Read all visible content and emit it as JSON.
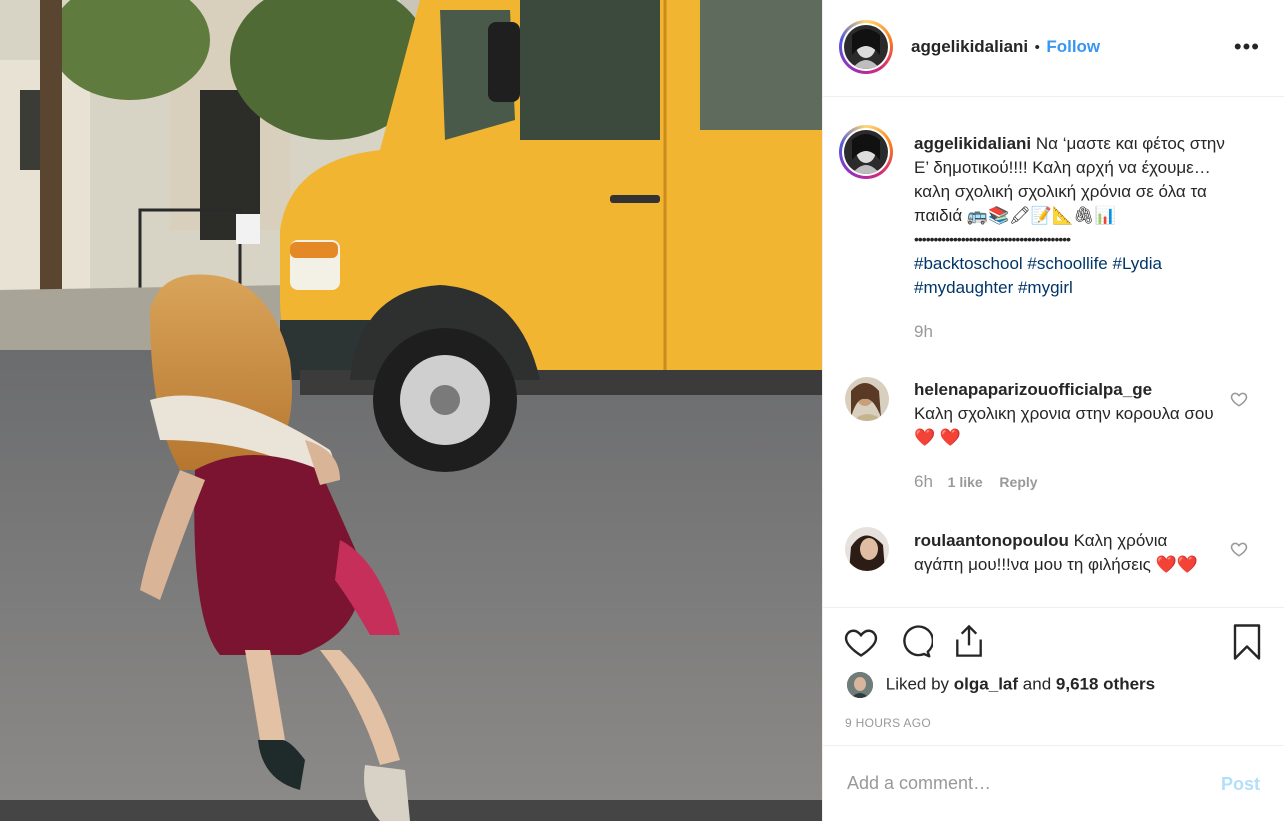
{
  "post": {
    "username": "aggelikidaliani",
    "separator": "•",
    "follow_label": "Follow",
    "more_icon": "ellipsis-icon",
    "caption_text": "Να ‘μαστε και φέτος στην Ε’ δημοτικού!!!! Καλη αρχή να έχουμε… καλη σχολική σχολική χρόνια σε όλα τα παιδιά 🚌📚🖍📝📐🖇📊",
    "divider": "••••••••••••••••••••••••••••••••••••••••",
    "hashtags": [
      "#backtoschool",
      "#schoollife",
      "#Lydia",
      "#mydaughter",
      "#mygirl"
    ],
    "caption_age": "9h"
  },
  "comments": [
    {
      "username": "helenapaparizouofficialpa_ge",
      "text": "Καλη σχολικη χρονια στην κορουλα σου❤️ ❤️",
      "age": "6h",
      "likes": "1 like",
      "reply": "Reply"
    },
    {
      "username": "roulaantonopoulou",
      "text": "Καλη χρόνια αγάπη μου!!!να μου τη φιλήσεις ❤️❤️"
    }
  ],
  "engagement": {
    "liked_by_prefix": "Liked by",
    "liked_by_user": "olga_laf",
    "and": "and",
    "others": "9,618 others",
    "timestamp": "9 HOURS AGO"
  },
  "add_comment": {
    "placeholder": "Add a comment…",
    "post_label": "Post"
  },
  "colors": {
    "link": "#3897f0",
    "hashtag": "#003569",
    "muted": "#999999",
    "post_disabled": "#b2dffc"
  }
}
